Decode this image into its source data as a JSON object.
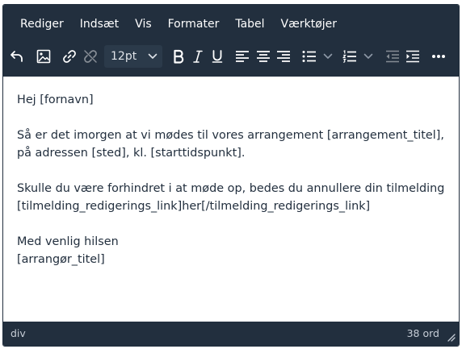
{
  "menubar": {
    "items": [
      "Rediger",
      "Indsæt",
      "Vis",
      "Formater",
      "Tabel",
      "Værktøjer"
    ]
  },
  "toolbar": {
    "font_size": "12pt",
    "icons": [
      "undo-icon",
      "image-icon",
      "link-icon",
      "unlink-icon",
      "bold-icon",
      "italic-icon",
      "underline-icon",
      "align-left-icon",
      "align-center-icon",
      "align-right-icon",
      "bullet-list-icon",
      "numbered-list-icon",
      "outdent-icon",
      "indent-icon",
      "more-icon"
    ]
  },
  "content": {
    "greeting": "Hej [fornavn]",
    "para1_line1": "Så er det imorgen at vi mødes til vores arrangement [arrangement_titel],",
    "para1_line2": "på adressen [sted], kl. [starttidspunkt].",
    "para2_line1": "Skulle du være forhindret i at møde op, bedes du annullere din tilmelding",
    "para2_line2": "[tilmelding_redigerings_link]her[/tilmelding_redigerings_link]",
    "closing_line1": "Med venlig hilsen",
    "closing_line2": "[arrangør_titel]"
  },
  "statusbar": {
    "path": "div",
    "word_count": "38 ord"
  },
  "colors": {
    "chrome": "#222f3e",
    "text": "#222f3e",
    "icon": "#ffffff"
  }
}
